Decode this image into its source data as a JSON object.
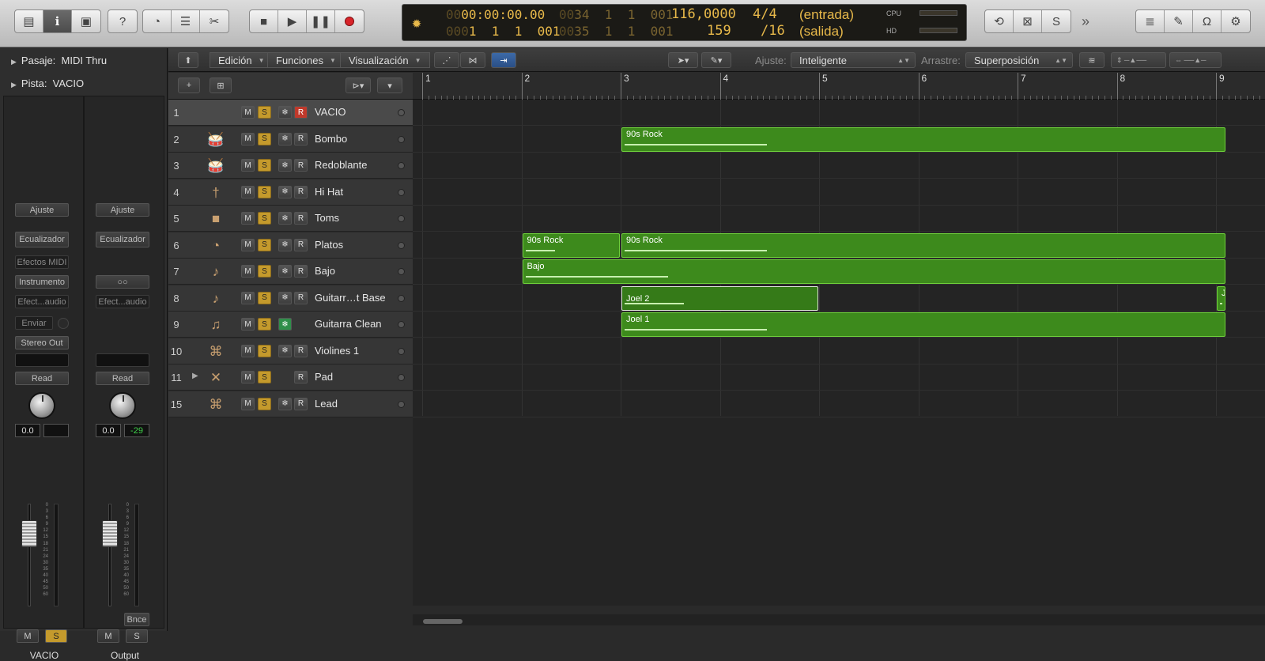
{
  "lcd": {
    "time_dim": "00",
    "time": "00:00:00.00",
    "pos_in_dim": "00",
    "pos_in": "34  1  1  001",
    "tempo": "116,0000",
    "sig": "4/4",
    "in_label": "(entrada)",
    "pos_in2_dim": "000",
    "pos_in2": "1  1  1  001",
    "pos_out_dim": "00",
    "pos_out": "35  1  1  001",
    "key": "159",
    "div": "/16",
    "out_label": "(salida)",
    "cpu_label": "CPU",
    "hd_label": "HD"
  },
  "inspector": {
    "region_label": "Pasaje:",
    "region_value": "MIDI Thru",
    "track_label": "Pista:",
    "track_value": "VACIO"
  },
  "strips": {
    "left": {
      "ajuste": "Ajuste",
      "eq": "Ecualizador",
      "midi_fx": "Efectos MIDI",
      "instrument": "Instrumento",
      "audio_fx": "Efect...audio",
      "send": "Enviar",
      "output": "Stereo Out",
      "read": "Read",
      "pan_value": "0.0",
      "peak_value": "",
      "m": "M",
      "s": "S",
      "name": "VACIO"
    },
    "right": {
      "ajuste": "Ajuste",
      "eq": "Ecualizador",
      "audio_fx": "Efect...audio",
      "link": "○○",
      "read": "Read",
      "pan_value": "0.0",
      "peak_value": "-29",
      "bnce": "Bnce",
      "m": "M",
      "s": "S",
      "name": "Output"
    },
    "scale": [
      "0",
      "3",
      "6",
      "9",
      "12",
      "15",
      "18",
      "21",
      "24",
      "30",
      "35",
      "40",
      "45",
      "50",
      "60"
    ]
  },
  "arrange_toolbar": {
    "edit": "Edición",
    "functions": "Funciones",
    "view": "Visualización",
    "snap_label": "Ajuste:",
    "snap_value": "Inteligente",
    "drag_label": "Arrastre:",
    "drag_value": "Superposición"
  },
  "ruler": [
    "1",
    "2",
    "3",
    "4",
    "5",
    "6",
    "7",
    "8",
    "9"
  ],
  "tracks": [
    {
      "num": "1",
      "name": "VACIO",
      "icon": " ",
      "rec": true,
      "freeze": true,
      "selected": true
    },
    {
      "num": "2",
      "name": "Bombo",
      "icon": "🥁",
      "rec": false,
      "freeze": true
    },
    {
      "num": "3",
      "name": "Redoblante",
      "icon": "🥁",
      "rec": false,
      "freeze": true
    },
    {
      "num": "4",
      "name": "Hi Hat",
      "icon": "†",
      "rec": false,
      "freeze": true
    },
    {
      "num": "5",
      "name": "Toms",
      "icon": "■",
      "rec": false,
      "freeze": true
    },
    {
      "num": "6",
      "name": "Platos",
      "icon": "◔",
      "rec": false,
      "freeze": true
    },
    {
      "num": "7",
      "name": "Bajo",
      "icon": "♪",
      "rec": false,
      "freeze": true
    },
    {
      "num": "8",
      "name": "Guitarr…t Base",
      "icon": "♪",
      "rec": false,
      "freeze": true
    },
    {
      "num": "9",
      "name": "Guitarra Clean",
      "icon": "♫",
      "rec": false,
      "freeze": true,
      "freeze_on": true
    },
    {
      "num": "10",
      "name": "Violines 1",
      "icon": "⌘",
      "rec": false,
      "freeze": true
    },
    {
      "num": "11",
      "name": "Pad",
      "icon": "✕",
      "rec": false,
      "freeze": false,
      "folder": true
    },
    {
      "num": "15",
      "name": "Lead",
      "icon": "⌘",
      "rec": false,
      "freeze": true
    }
  ],
  "track_buttons": {
    "m": "M",
    "s": "S",
    "r": "R",
    "freeze": "❄"
  },
  "regions": [
    {
      "lane": 1,
      "name": "90s Rock",
      "start": 3,
      "end": 9.1
    },
    {
      "lane": 5,
      "name": "90s Rock",
      "start": 2,
      "end": 3
    },
    {
      "lane": 5,
      "name": "90s Rock",
      "start": 3,
      "end": 9.1
    },
    {
      "lane": 6,
      "name": "Bajo",
      "start": 2,
      "end": 9.1
    },
    {
      "lane": 7,
      "name": "Joel 2",
      "start": 3,
      "end": 5,
      "selected": true
    },
    {
      "lane": 7,
      "name": "Jo",
      "start": 9,
      "end": 9.1
    },
    {
      "lane": 8,
      "name": "Joel 1",
      "start": 3,
      "end": 9.1
    }
  ],
  "colors": {
    "region": "#3d8a1c",
    "solo": "#c49a2c",
    "record": "#c0392b",
    "freeze_on": "#2f8f4a",
    "lcd_text": "#e8b94a"
  }
}
